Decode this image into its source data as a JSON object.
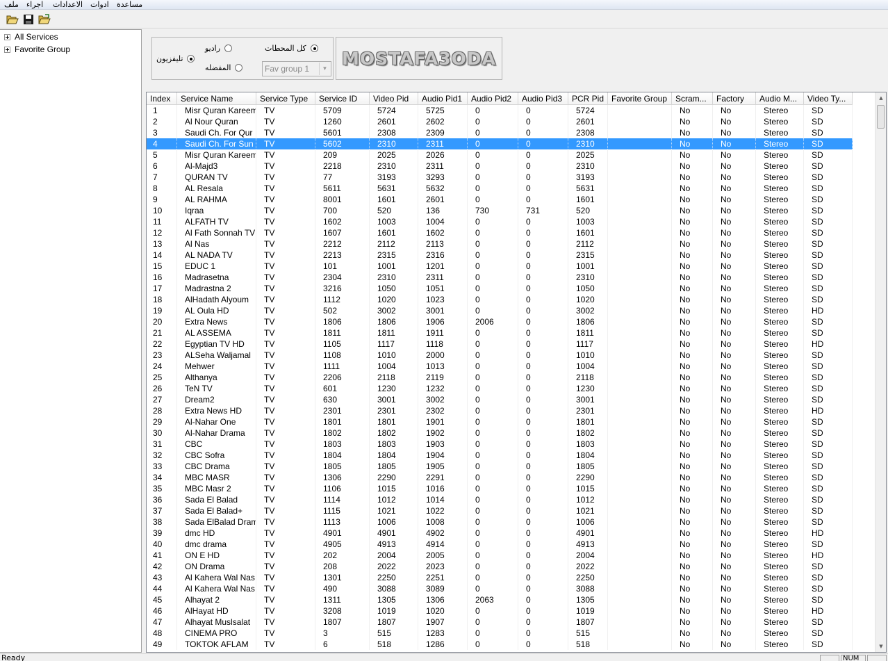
{
  "menu": [
    "ملف",
    "اجراء",
    "الاعدادات",
    "ادوات",
    "مساعدة"
  ],
  "toolbar": {
    "icons": [
      "open-folder-icon",
      "save-icon",
      "open-file-icon"
    ]
  },
  "tree": {
    "items": [
      "All Services",
      "Favorite Group"
    ]
  },
  "filter": {
    "tv_label": "تليفزيون",
    "radio_label": "راديو",
    "all_label": "كل المحطات",
    "fav_label": "المفضله",
    "fav_select_value": "Fav group 1",
    "tv_checked": true,
    "all_checked": true
  },
  "logo": {
    "text": "MOSTAFA3ODA"
  },
  "grid": {
    "columns": [
      "Index",
      "Service Name",
      "Service Type",
      "Service ID",
      "Video Pid",
      "Audio Pid1",
      "Audio Pid2",
      "Audio Pid3",
      "PCR Pid",
      "Favorite Group",
      "Scram...",
      "Factory",
      "Audio M...",
      "Video Ty..."
    ],
    "selected_index": 3,
    "rows": [
      [
        "1",
        "Misr Quran Kareem",
        "TV",
        "5709",
        "5724",
        "5725",
        "0",
        "0",
        "5724",
        "",
        "No",
        "No",
        "Stereo",
        "SD"
      ],
      [
        "2",
        "Al Nour Quran",
        "TV",
        "1260",
        "2601",
        "2602",
        "0",
        "0",
        "2601",
        "",
        "No",
        "No",
        "Stereo",
        "SD"
      ],
      [
        "3",
        "Saudi Ch. For Qur",
        "TV",
        "5601",
        "2308",
        "2309",
        "0",
        "0",
        "2308",
        "",
        "No",
        "No",
        "Stereo",
        "SD"
      ],
      [
        "4",
        "Saudi Ch. For Sun",
        "TV",
        "5602",
        "2310",
        "2311",
        "0",
        "0",
        "2310",
        "",
        "No",
        "No",
        "Stereo",
        "SD"
      ],
      [
        "5",
        "Misr Quran Kareem",
        "TV",
        "209",
        "2025",
        "2026",
        "0",
        "0",
        "2025",
        "",
        "No",
        "No",
        "Stereo",
        "SD"
      ],
      [
        "6",
        "Al-Majd3",
        "TV",
        "2218",
        "2310",
        "2311",
        "0",
        "0",
        "2310",
        "",
        "No",
        "No",
        "Stereo",
        "SD"
      ],
      [
        "7",
        "QURAN TV",
        "TV",
        "77",
        "3193",
        "3293",
        "0",
        "0",
        "3193",
        "",
        "No",
        "No",
        "Stereo",
        "SD"
      ],
      [
        "8",
        "AL Resala",
        "TV",
        "5611",
        "5631",
        "5632",
        "0",
        "0",
        "5631",
        "",
        "No",
        "No",
        "Stereo",
        "SD"
      ],
      [
        "9",
        "AL RAHMA",
        "TV",
        "8001",
        "1601",
        "2601",
        "0",
        "0",
        "1601",
        "",
        "No",
        "No",
        "Stereo",
        "SD"
      ],
      [
        "10",
        "Iqraa",
        "TV",
        "700",
        "520",
        "136",
        "730",
        "731",
        "520",
        "",
        "No",
        "No",
        "Stereo",
        "SD"
      ],
      [
        "11",
        "ALFATH TV",
        "TV",
        "1602",
        "1003",
        "1004",
        "0",
        "0",
        "1003",
        "",
        "No",
        "No",
        "Stereo",
        "SD"
      ],
      [
        "12",
        "Al Fath Sonnah TV",
        "TV",
        "1607",
        "1601",
        "1602",
        "0",
        "0",
        "1601",
        "",
        "No",
        "No",
        "Stereo",
        "SD"
      ],
      [
        "13",
        "Al Nas",
        "TV",
        "2212",
        "2112",
        "2113",
        "0",
        "0",
        "2112",
        "",
        "No",
        "No",
        "Stereo",
        "SD"
      ],
      [
        "14",
        "AL NADA TV",
        "TV",
        "2213",
        "2315",
        "2316",
        "0",
        "0",
        "2315",
        "",
        "No",
        "No",
        "Stereo",
        "SD"
      ],
      [
        "15",
        "EDUC 1",
        "TV",
        "101",
        "1001",
        "1201",
        "0",
        "0",
        "1001",
        "",
        "No",
        "No",
        "Stereo",
        "SD"
      ],
      [
        "16",
        "Madrasetna",
        "TV",
        "2304",
        "2310",
        "2311",
        "0",
        "0",
        "2310",
        "",
        "No",
        "No",
        "Stereo",
        "SD"
      ],
      [
        "17",
        "Madrastna 2",
        "TV",
        "3216",
        "1050",
        "1051",
        "0",
        "0",
        "1050",
        "",
        "No",
        "No",
        "Stereo",
        "SD"
      ],
      [
        "18",
        "AlHadath Alyoum",
        "TV",
        "1112",
        "1020",
        "1023",
        "0",
        "0",
        "1020",
        "",
        "No",
        "No",
        "Stereo",
        "SD"
      ],
      [
        "19",
        "AL Oula HD",
        "TV",
        "502",
        "3002",
        "3001",
        "0",
        "0",
        "3002",
        "",
        "No",
        "No",
        "Stereo",
        "HD"
      ],
      [
        "20",
        "Extra News",
        "TV",
        "1806",
        "1806",
        "1906",
        "2006",
        "0",
        "1806",
        "",
        "No",
        "No",
        "Stereo",
        "SD"
      ],
      [
        "21",
        "AL ASSEMA",
        "TV",
        "1811",
        "1811",
        "1911",
        "0",
        "0",
        "1811",
        "",
        "No",
        "No",
        "Stereo",
        "SD"
      ],
      [
        "22",
        "Egyptian TV HD",
        "TV",
        "1105",
        "1117",
        "1118",
        "0",
        "0",
        "1117",
        "",
        "No",
        "No",
        "Stereo",
        "HD"
      ],
      [
        "23",
        "ALSeha Waljamal",
        "TV",
        "1108",
        "1010",
        "2000",
        "0",
        "0",
        "1010",
        "",
        "No",
        "No",
        "Stereo",
        "SD"
      ],
      [
        "24",
        "Mehwer",
        "TV",
        "1111",
        "1004",
        "1013",
        "0",
        "0",
        "1004",
        "",
        "No",
        "No",
        "Stereo",
        "SD"
      ],
      [
        "25",
        "Althanya",
        "TV",
        "2206",
        "2118",
        "2119",
        "0",
        "0",
        "2118",
        "",
        "No",
        "No",
        "Stereo",
        "SD"
      ],
      [
        "26",
        "TeN TV",
        "TV",
        "601",
        "1230",
        "1232",
        "0",
        "0",
        "1230",
        "",
        "No",
        "No",
        "Stereo",
        "SD"
      ],
      [
        "27",
        "Dream2",
        "TV",
        "630",
        "3001",
        "3002",
        "0",
        "0",
        "3001",
        "",
        "No",
        "No",
        "Stereo",
        "SD"
      ],
      [
        "28",
        "Extra News HD",
        "TV",
        "2301",
        "2301",
        "2302",
        "0",
        "0",
        "2301",
        "",
        "No",
        "No",
        "Stereo",
        "HD"
      ],
      [
        "29",
        "Al-Nahar One",
        "TV",
        "1801",
        "1801",
        "1901",
        "0",
        "0",
        "1801",
        "",
        "No",
        "No",
        "Stereo",
        "SD"
      ],
      [
        "30",
        "Al-Nahar Drama",
        "TV",
        "1802",
        "1802",
        "1902",
        "0",
        "0",
        "1802",
        "",
        "No",
        "No",
        "Stereo",
        "SD"
      ],
      [
        "31",
        "CBC",
        "TV",
        "1803",
        "1803",
        "1903",
        "0",
        "0",
        "1803",
        "",
        "No",
        "No",
        "Stereo",
        "SD"
      ],
      [
        "32",
        "CBC Sofra",
        "TV",
        "1804",
        "1804",
        "1904",
        "0",
        "0",
        "1804",
        "",
        "No",
        "No",
        "Stereo",
        "SD"
      ],
      [
        "33",
        "CBC Drama",
        "TV",
        "1805",
        "1805",
        "1905",
        "0",
        "0",
        "1805",
        "",
        "No",
        "No",
        "Stereo",
        "SD"
      ],
      [
        "34",
        "MBC MASR",
        "TV",
        "1306",
        "2290",
        "2291",
        "0",
        "0",
        "2290",
        "",
        "No",
        "No",
        "Stereo",
        "SD"
      ],
      [
        "35",
        "MBC Masr 2",
        "TV",
        "1106",
        "1015",
        "1016",
        "0",
        "0",
        "1015",
        "",
        "No",
        "No",
        "Stereo",
        "SD"
      ],
      [
        "36",
        "Sada El Balad",
        "TV",
        "1114",
        "1012",
        "1014",
        "0",
        "0",
        "1012",
        "",
        "No",
        "No",
        "Stereo",
        "SD"
      ],
      [
        "37",
        "Sada El Balad+",
        "TV",
        "1115",
        "1021",
        "1022",
        "0",
        "0",
        "1021",
        "",
        "No",
        "No",
        "Stereo",
        "SD"
      ],
      [
        "38",
        "Sada ElBalad Dram",
        "TV",
        "1113",
        "1006",
        "1008",
        "0",
        "0",
        "1006",
        "",
        "No",
        "No",
        "Stereo",
        "SD"
      ],
      [
        "39",
        "dmc HD",
        "TV",
        "4901",
        "4901",
        "4902",
        "0",
        "0",
        "4901",
        "",
        "No",
        "No",
        "Stereo",
        "HD"
      ],
      [
        "40",
        "dmc drama",
        "TV",
        "4905",
        "4913",
        "4914",
        "0",
        "0",
        "4913",
        "",
        "No",
        "No",
        "Stereo",
        "SD"
      ],
      [
        "41",
        "ON  E HD",
        "TV",
        "202",
        "2004",
        "2005",
        "0",
        "0",
        "2004",
        "",
        "No",
        "No",
        "Stereo",
        "HD"
      ],
      [
        "42",
        "ON Drama",
        "TV",
        "208",
        "2022",
        "2023",
        "0",
        "0",
        "2022",
        "",
        "No",
        "No",
        "Stereo",
        "SD"
      ],
      [
        "43",
        "Al Kahera Wal Nas",
        "TV",
        "1301",
        "2250",
        "2251",
        "0",
        "0",
        "2250",
        "",
        "No",
        "No",
        "Stereo",
        "SD"
      ],
      [
        "44",
        "Al Kahera Wal Nas",
        "TV",
        "490",
        "3088",
        "3089",
        "0",
        "0",
        "3088",
        "",
        "No",
        "No",
        "Stereo",
        "SD"
      ],
      [
        "45",
        "Alhayat 2",
        "TV",
        "1311",
        "1305",
        "1306",
        "2063",
        "0",
        "1305",
        "",
        "No",
        "No",
        "Stereo",
        "SD"
      ],
      [
        "46",
        "AlHayat HD",
        "TV",
        "3208",
        "1019",
        "1020",
        "0",
        "0",
        "1019",
        "",
        "No",
        "No",
        "Stereo",
        "HD"
      ],
      [
        "47",
        "Alhayat Muslsalat",
        "TV",
        "1807",
        "1807",
        "1907",
        "0",
        "0",
        "1807",
        "",
        "No",
        "No",
        "Stereo",
        "SD"
      ],
      [
        "48",
        "CINEMA PRO",
        "TV",
        "3",
        "515",
        "1283",
        "0",
        "0",
        "515",
        "",
        "No",
        "No",
        "Stereo",
        "SD"
      ],
      [
        "49",
        "TOKTOK AFLAM",
        "TV",
        "6",
        "518",
        "1286",
        "0",
        "0",
        "518",
        "",
        "No",
        "No",
        "Stereo",
        "SD"
      ]
    ]
  },
  "status": {
    "text": "Ready",
    "num": "NUM"
  },
  "colors": {
    "selection": "#3399ff",
    "menubar": "#dfe6f2"
  }
}
